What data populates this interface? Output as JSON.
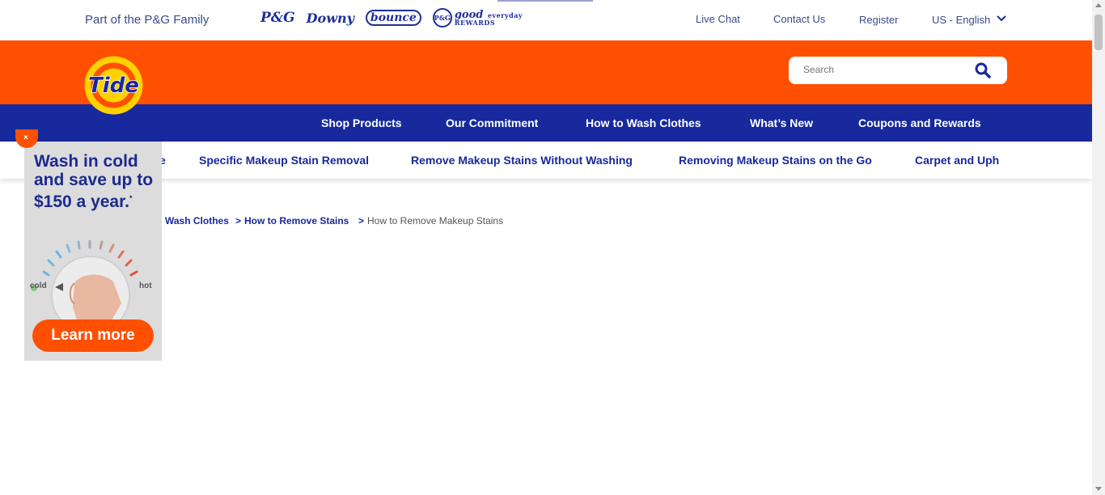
{
  "topbar": {
    "family_text": "Part of the P&G Family",
    "brands": [
      "P&G",
      "Downy",
      "bounce",
      "P&G",
      "good",
      "everyday",
      "REWARDS"
    ],
    "live_chat": "Live Chat",
    "contact_us": "Contact Us",
    "register": "Register",
    "locale": "US - English"
  },
  "header": {
    "logo_text": "Tide",
    "search_placeholder": "Search"
  },
  "main_nav": {
    "items": [
      "Shop Products",
      "Our Commitment",
      "How to Wash Clothes",
      "What’s New",
      "Coupons and Rewards"
    ]
  },
  "sub_nav": {
    "items": [
      "e",
      "Specific Makeup Stain Removal",
      "Remove Makeup Stains Without Washing",
      "Removing Makeup Stains on the Go",
      "Carpet and Uph"
    ]
  },
  "breadcrumb": {
    "items": [
      "Wash Clothes",
      ">",
      "How to Remove Stains",
      ">",
      "How to Remove Makeup Stains"
    ]
  },
  "ad": {
    "headline": "Wash in cold and save up to $150 a year.",
    "asterisk": "*",
    "cold_label": "cold",
    "hot_label": "hot",
    "cta": "Learn more"
  },
  "colors": {
    "orange": "#fe5000",
    "blue": "#17299c",
    "yellow": "#ffd100"
  }
}
